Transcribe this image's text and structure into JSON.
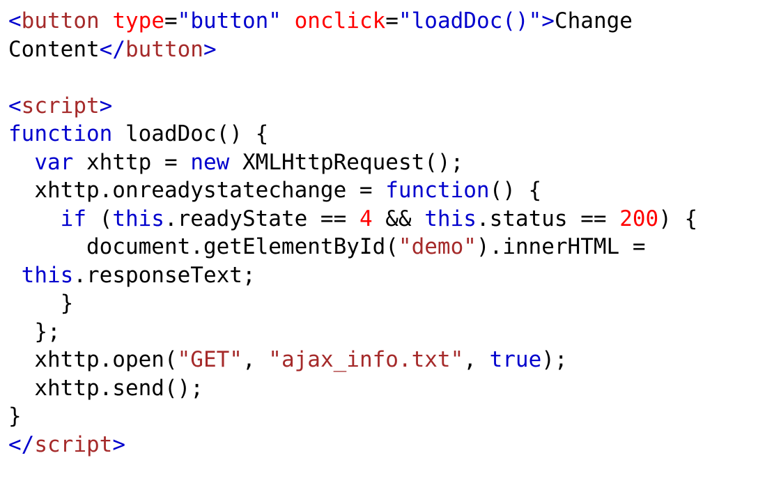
{
  "colors": {
    "text": "#000000",
    "tag": "#a52a2a",
    "attr": "#ff0000",
    "string": "#a52a2a",
    "attrval": "#0000cd",
    "keyword": "#0000cd",
    "number": "#ff0000",
    "bracket": "#0000cd",
    "background": "#ffffff"
  },
  "code": {
    "lines": [
      [
        {
          "t": "<",
          "c": "bracket"
        },
        {
          "t": "button",
          "c": "tag"
        },
        {
          "t": " ",
          "c": "text"
        },
        {
          "t": "type",
          "c": "attr"
        },
        {
          "t": "=",
          "c": "text"
        },
        {
          "t": "\"button\"",
          "c": "attrval"
        },
        {
          "t": " ",
          "c": "text"
        },
        {
          "t": "onclick",
          "c": "attr"
        },
        {
          "t": "=",
          "c": "text"
        },
        {
          "t": "\"loadDoc()\"",
          "c": "attrval"
        },
        {
          "t": ">",
          "c": "bracket"
        },
        {
          "t": "Change",
          "c": "text"
        }
      ],
      [
        {
          "t": "Content",
          "c": "text"
        },
        {
          "t": "</",
          "c": "bracket"
        },
        {
          "t": "button",
          "c": "tag"
        },
        {
          "t": ">",
          "c": "bracket"
        }
      ],
      [],
      [
        {
          "t": "<",
          "c": "bracket"
        },
        {
          "t": "script",
          "c": "tag"
        },
        {
          "t": ">",
          "c": "bracket"
        }
      ],
      [
        {
          "t": "function",
          "c": "keyword"
        },
        {
          "t": " loadDoc() {",
          "c": "text"
        }
      ],
      [
        {
          "t": "  ",
          "c": "text"
        },
        {
          "t": "var",
          "c": "keyword"
        },
        {
          "t": " xhttp = ",
          "c": "text"
        },
        {
          "t": "new",
          "c": "keyword"
        },
        {
          "t": " XMLHttpRequest();",
          "c": "text"
        }
      ],
      [
        {
          "t": "  xhttp.onreadystatechange = ",
          "c": "text"
        },
        {
          "t": "function",
          "c": "keyword"
        },
        {
          "t": "() {",
          "c": "text"
        }
      ],
      [
        {
          "t": "    ",
          "c": "text"
        },
        {
          "t": "if",
          "c": "keyword"
        },
        {
          "t": " (",
          "c": "text"
        },
        {
          "t": "this",
          "c": "keyword"
        },
        {
          "t": ".readyState == ",
          "c": "text"
        },
        {
          "t": "4",
          "c": "number"
        },
        {
          "t": " && ",
          "c": "text"
        },
        {
          "t": "this",
          "c": "keyword"
        },
        {
          "t": ".status == ",
          "c": "text"
        },
        {
          "t": "200",
          "c": "number"
        },
        {
          "t": ") {",
          "c": "text"
        }
      ],
      [
        {
          "t": "      document.getElementById(",
          "c": "text"
        },
        {
          "t": "\"demo\"",
          "c": "string"
        },
        {
          "t": ").innerHTML =",
          "c": "text"
        }
      ],
      [
        {
          "t": " ",
          "c": "text"
        },
        {
          "t": "this",
          "c": "keyword"
        },
        {
          "t": ".responseText;",
          "c": "text"
        }
      ],
      [
        {
          "t": "    }",
          "c": "text"
        }
      ],
      [
        {
          "t": "  };",
          "c": "text"
        }
      ],
      [
        {
          "t": "  xhttp.open(",
          "c": "text"
        },
        {
          "t": "\"GET\"",
          "c": "string"
        },
        {
          "t": ", ",
          "c": "text"
        },
        {
          "t": "\"ajax_info.txt\"",
          "c": "string"
        },
        {
          "t": ", ",
          "c": "text"
        },
        {
          "t": "true",
          "c": "keyword"
        },
        {
          "t": ");",
          "c": "text"
        }
      ],
      [
        {
          "t": "  xhttp.send();",
          "c": "text"
        }
      ],
      [
        {
          "t": "}",
          "c": "text"
        }
      ],
      [
        {
          "t": "</",
          "c": "bracket"
        },
        {
          "t": "script",
          "c": "tag"
        },
        {
          "t": ">",
          "c": "bracket"
        }
      ]
    ]
  }
}
